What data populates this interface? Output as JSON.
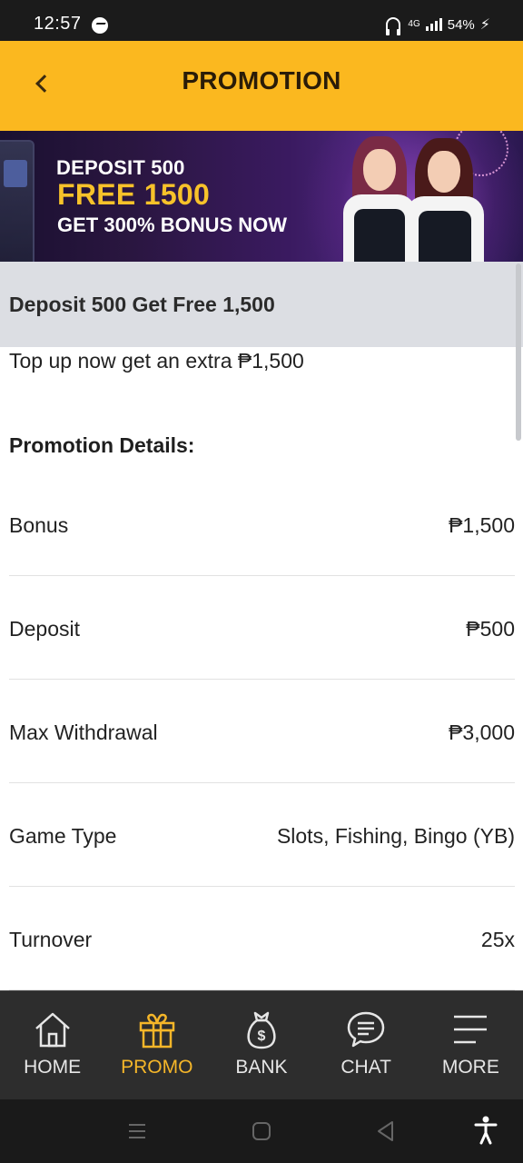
{
  "status_bar": {
    "time": "12:57",
    "network": "4G",
    "battery": "54%",
    "icons": [
      "messenger-icon",
      "headset-icon",
      "signal-icon",
      "charging-icon"
    ]
  },
  "header": {
    "title": "PROMOTION",
    "back_icon": "chevron-left-icon",
    "background_color": "#fbb81f"
  },
  "banner": {
    "line1": "DEPOSIT 500",
    "line2": "FREE 1500",
    "line3": "GET 300% BONUS NOW",
    "highlight_color": "#f7c22a"
  },
  "promo": {
    "name": "Deposit 500 Get Free 1,500",
    "description": "Top up now get an extra ₱1,500",
    "details_heading": "Promotion Details:",
    "details": [
      {
        "label": "Bonus",
        "value": "₱1,500"
      },
      {
        "label": "Deposit",
        "value": "₱500"
      },
      {
        "label": "Max Withdrawal",
        "value": "₱3,000"
      },
      {
        "label": "Game Type",
        "value": "Slots, Fishing, Bingo (YB)"
      },
      {
        "label": "Turnover",
        "value": "25x"
      }
    ]
  },
  "bottom_nav": {
    "active_color": "#f5b629",
    "items": [
      {
        "label": "HOME",
        "icon": "home-icon",
        "active": false
      },
      {
        "label": "PROMO",
        "icon": "gift-icon",
        "active": true
      },
      {
        "label": "BANK",
        "icon": "money-bag-icon",
        "active": false
      },
      {
        "label": "CHAT",
        "icon": "chat-icon",
        "active": false
      },
      {
        "label": "MORE",
        "icon": "menu-icon",
        "active": false
      }
    ]
  }
}
